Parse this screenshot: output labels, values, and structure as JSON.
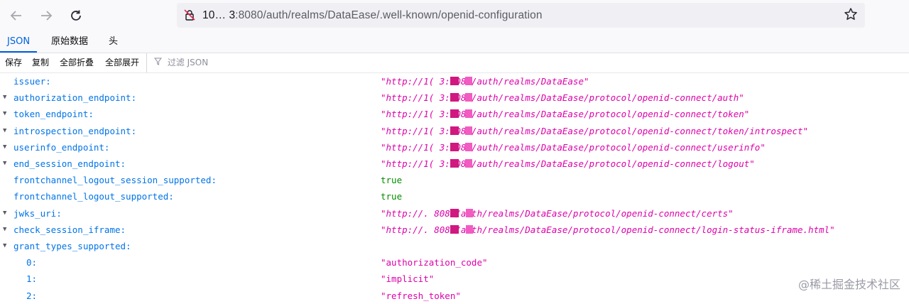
{
  "toolbar": {
    "url_host": "10…  3",
    "url_rest": ":8080/auth/realms/DataEase/.well-known/openid-configuration",
    "back_icon": "arrow-left-icon",
    "forward_icon": "arrow-right-icon",
    "reload_icon": "reload-icon",
    "bookmark_icon": "star-icon"
  },
  "tabs": [
    "JSON",
    "原始数据",
    "头"
  ],
  "actions": {
    "save": "保存",
    "copy": "复制",
    "collapse_all": "全部折叠",
    "expand_all": "全部展开",
    "filter_placeholder": "过滤 JSON"
  },
  "rows": [
    {
      "key": "issuer:",
      "value": "\"http://1(          3:8080/auth/realms/DataEase\"",
      "type": "str"
    },
    {
      "key": "authorization_endpoint:",
      "value": "\"http://1(          3:8080/auth/realms/DataEase/protocol/openid-connect/auth\"",
      "type": "str"
    },
    {
      "key": "token_endpoint:",
      "value": "\"http://1(          3:8080/auth/realms/DataEase/protocol/openid-connect/token\"",
      "type": "str"
    },
    {
      "key": "introspection_endpoint:",
      "value": "\"http://1(          3:8080/auth/realms/DataEase/protocol/openid-connect/token/introspect\"",
      "type": "str"
    },
    {
      "key": "userinfo_endpoint:",
      "value": "\"http://1(          3:8080/auth/realms/DataEase/protocol/openid-connect/userinfo\"",
      "type": "str"
    },
    {
      "key": "end_session_endpoint:",
      "value": "\"http://1(          3:8080/auth/realms/DataEase/protocol/openid-connect/logout\"",
      "type": "str"
    },
    {
      "key": "frontchannel_logout_session_supported:",
      "value": "true",
      "type": "bool"
    },
    {
      "key": "frontchannel_logout_supported:",
      "value": "true",
      "type": "bool"
    },
    {
      "key": "jwks_uri:",
      "value": "\"http://.           8080/auth/realms/DataEase/protocol/openid-connect/certs\"",
      "type": "str"
    },
    {
      "key": "check_session_iframe:",
      "value": "\"http://.           8080/auth/realms/DataEase/protocol/openid-connect/login-status-iframe.html\"",
      "type": "str"
    },
    {
      "key": "grant_types_supported:",
      "value": "",
      "type": "none"
    },
    {
      "key": "0:",
      "value": "\"authorization_code\"",
      "type": "plain"
    },
    {
      "key": "1:",
      "value": "\"implicit\"",
      "type": "plain"
    },
    {
      "key": "2:",
      "value": "\"refresh_token\"",
      "type": "plain"
    }
  ],
  "watermark": "@稀土掘金技术社区",
  "colors": {
    "key": "#0074e8",
    "string": "#dd00a9",
    "bool": "#058b00",
    "redact_dark": "#d0187f",
    "redact_light": "#f25cc0"
  }
}
